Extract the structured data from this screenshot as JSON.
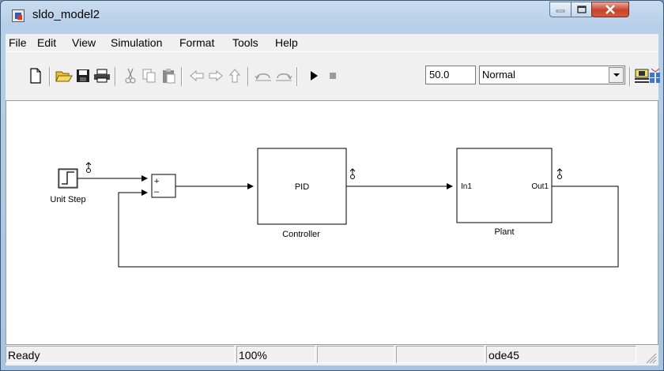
{
  "window": {
    "title": "sldo_model2"
  },
  "menu": [
    "File",
    "Edit",
    "View",
    "Simulation",
    "Format",
    "Tools",
    "Help"
  ],
  "toolbar": {
    "stop_time": "50.0",
    "sim_mode": "Normal"
  },
  "diagram": {
    "step_label": "Unit Step",
    "sum_plus": "+",
    "sum_minus": "–",
    "pid_text": "PID",
    "controller_label": "Controller",
    "plant_in_port": "In1",
    "plant_out_port": "Out1",
    "plant_label": "Plant"
  },
  "status": {
    "text": "Ready",
    "zoom": "100%",
    "solver": "ode45"
  }
}
